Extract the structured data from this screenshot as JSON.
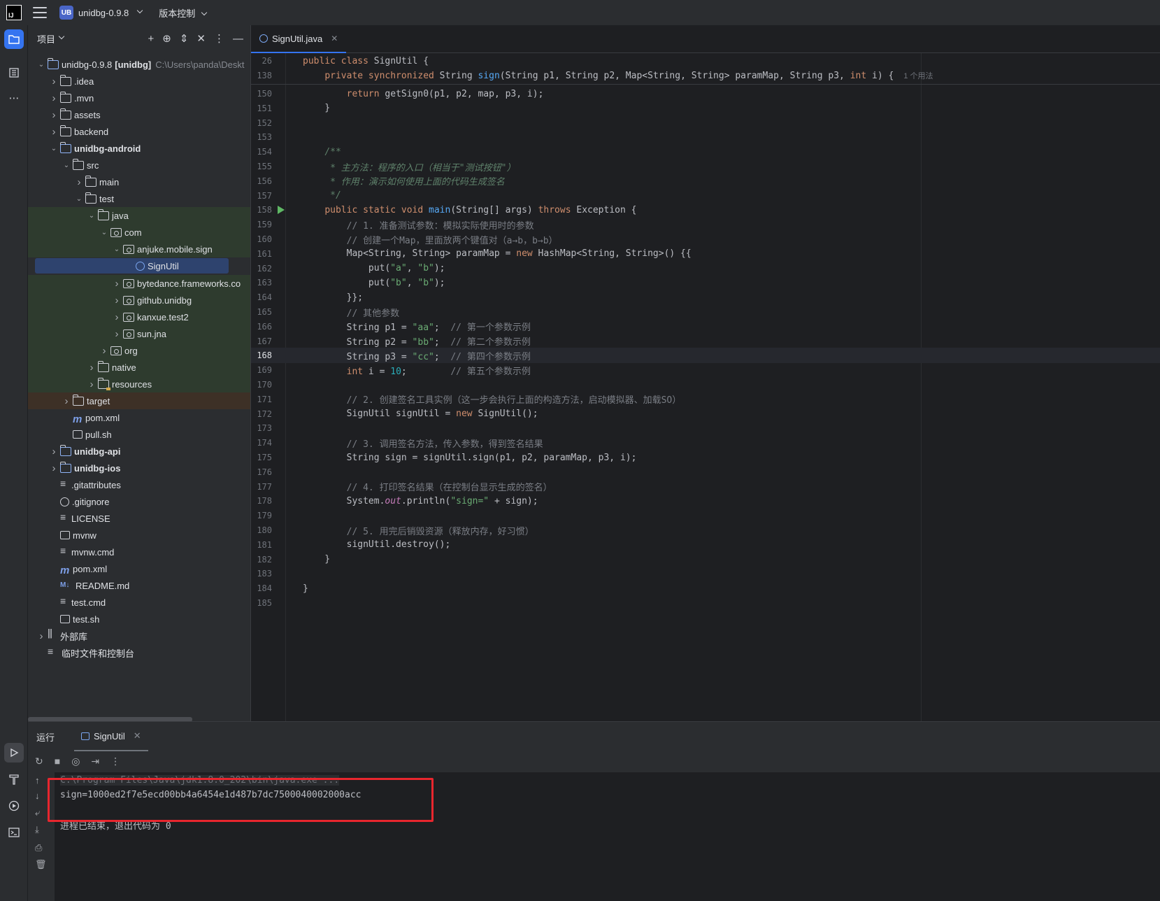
{
  "titlebar": {
    "logo_text": "IJ",
    "project_badge": "UB",
    "project_name": "unidbg-0.9.8",
    "vcs_label": "版本控制"
  },
  "project_panel": {
    "title": "项目",
    "tree": [
      {
        "label": "unidbg-0.9.8",
        "bold_suffix": "[unidbg]",
        "extra": "C:\\Users\\panda\\Deskt",
        "depth": 0,
        "arrow": "open",
        "icon": "module-folder-icon"
      },
      {
        "label": ".idea",
        "depth": 1,
        "arrow": "closed",
        "icon": "folder-icon"
      },
      {
        "label": ".mvn",
        "depth": 1,
        "arrow": "closed",
        "icon": "folder-icon"
      },
      {
        "label": "assets",
        "depth": 1,
        "arrow": "closed",
        "icon": "folder-icon"
      },
      {
        "label": "backend",
        "depth": 1,
        "arrow": "closed",
        "icon": "folder-icon"
      },
      {
        "label": "unidbg-android",
        "depth": 1,
        "arrow": "open",
        "icon": "module-folder-icon",
        "bold": true
      },
      {
        "label": "src",
        "depth": 2,
        "arrow": "open",
        "icon": "folder-icon"
      },
      {
        "label": "main",
        "depth": 3,
        "arrow": "closed",
        "icon": "folder-icon"
      },
      {
        "label": "test",
        "depth": 3,
        "arrow": "open",
        "icon": "folder-icon"
      },
      {
        "label": "java",
        "depth": 4,
        "arrow": "open",
        "icon": "folder-icon",
        "bg": "green"
      },
      {
        "label": "com",
        "depth": 5,
        "arrow": "open",
        "icon": "package-icon",
        "bg": "green"
      },
      {
        "label": "anjuke.mobile.sign",
        "depth": 6,
        "arrow": "open",
        "icon": "package-icon",
        "bg": "green"
      },
      {
        "label": "SignUtil",
        "depth": 7,
        "arrow": "none",
        "icon": "java-class-icon",
        "bg": "selected"
      },
      {
        "label": "bytedance.frameworks.co",
        "depth": 6,
        "arrow": "closed",
        "icon": "package-icon",
        "bg": "green"
      },
      {
        "label": "github.unidbg",
        "depth": 6,
        "arrow": "closed",
        "icon": "package-icon",
        "bg": "green"
      },
      {
        "label": "kanxue.test2",
        "depth": 6,
        "arrow": "closed",
        "icon": "package-icon",
        "bg": "green"
      },
      {
        "label": "sun.jna",
        "depth": 6,
        "arrow": "closed",
        "icon": "package-icon",
        "bg": "green"
      },
      {
        "label": "org",
        "depth": 5,
        "arrow": "closed",
        "icon": "package-icon",
        "bg": "green"
      },
      {
        "label": "native",
        "depth": 4,
        "arrow": "closed",
        "icon": "folder-icon",
        "bg": "green"
      },
      {
        "label": "resources",
        "depth": 4,
        "arrow": "closed",
        "icon": "resources-folder-icon",
        "bg": "green"
      },
      {
        "label": "target",
        "depth": 2,
        "arrow": "closed",
        "icon": "folder-icon",
        "bg": "brown"
      },
      {
        "label": "pom.xml",
        "depth": 2,
        "arrow": "none",
        "icon": "maven-icon"
      },
      {
        "label": "pull.sh",
        "depth": 2,
        "arrow": "none",
        "icon": "terminal-file-icon"
      },
      {
        "label": "unidbg-api",
        "depth": 1,
        "arrow": "closed",
        "icon": "module-folder-icon",
        "bold": true
      },
      {
        "label": "unidbg-ios",
        "depth": 1,
        "arrow": "closed",
        "icon": "module-folder-icon",
        "bold": true
      },
      {
        "label": ".gitattributes",
        "depth": 1,
        "arrow": "none",
        "icon": "text-file-icon"
      },
      {
        "label": ".gitignore",
        "depth": 1,
        "arrow": "none",
        "icon": "ignore-file-icon"
      },
      {
        "label": "LICENSE",
        "depth": 1,
        "arrow": "none",
        "icon": "text-file-icon"
      },
      {
        "label": "mvnw",
        "depth": 1,
        "arrow": "none",
        "icon": "terminal-file-icon"
      },
      {
        "label": "mvnw.cmd",
        "depth": 1,
        "arrow": "none",
        "icon": "text-file-icon"
      },
      {
        "label": "pom.xml",
        "depth": 1,
        "arrow": "none",
        "icon": "maven-icon"
      },
      {
        "label": "README.md",
        "depth": 1,
        "arrow": "none",
        "icon": "markdown-icon"
      },
      {
        "label": "test.cmd",
        "depth": 1,
        "arrow": "none",
        "icon": "text-file-icon"
      },
      {
        "label": "test.sh",
        "depth": 1,
        "arrow": "none",
        "icon": "terminal-file-icon"
      },
      {
        "label": "外部库",
        "depth": 0,
        "arrow": "closed",
        "icon": "library-icon"
      },
      {
        "label": "临时文件和控制台",
        "depth": 0,
        "arrow": "none",
        "icon": "scratches-icon"
      }
    ]
  },
  "editor": {
    "tab_label": "SignUtil.java",
    "usage_hint": "1 个用法",
    "lines": [
      {
        "n": "26",
        "html": "<span class=\"kw\">public class</span> SignUtil {"
      },
      {
        "n": "138",
        "html": "    <span class=\"kw\">private synchronized</span> String <span class=\"fn\">sign</span>(String p1, String p2, Map&lt;String, String&gt; paramMap, String p3, <span class=\"kw\">int</span> i) {"
      },
      {
        "n": "150",
        "html": "        <span class=\"kw\">return</span> getSign0(p1, p2, map, p3, i);"
      },
      {
        "n": "151",
        "html": "    }"
      },
      {
        "n": "152",
        "html": ""
      },
      {
        "n": "153",
        "html": ""
      },
      {
        "n": "154",
        "html": "    <span class=\"doc\">/**</span>"
      },
      {
        "n": "155",
        "html": "<span class=\"doc\">     * 主方法：程序的入口（相当于\"测试按钮\"）</span>"
      },
      {
        "n": "156",
        "html": "<span class=\"doc\">     * 作用：演示如何使用上面的代码生成签名</span>"
      },
      {
        "n": "157",
        "html": "<span class=\"doc\">     */</span>"
      },
      {
        "n": "158",
        "html": "    <span class=\"kw\">public static void</span> <span class=\"fn\">main</span>(String[] args) <span class=\"kw\">throws</span> Exception {"
      },
      {
        "n": "159",
        "html": "        <span class=\"cmt\">// 1. 准备测试参数：模拟实际使用时的参数</span>"
      },
      {
        "n": "160",
        "html": "        <span class=\"cmt\">// 创建一个Map，里面放两个键值对（a→b，b→b）</span>"
      },
      {
        "n": "161",
        "html": "        Map&lt;String, String&gt; paramMap = <span class=\"kw\">new</span> HashMap&lt;String, String&gt;() {{"
      },
      {
        "n": "162",
        "html": "            put(<span class=\"str\">\"a\"</span>, <span class=\"str\">\"b\"</span>);"
      },
      {
        "n": "163",
        "html": "            put(<span class=\"str\">\"b\"</span>, <span class=\"str\">\"b\"</span>);"
      },
      {
        "n": "164",
        "html": "        }};"
      },
      {
        "n": "165",
        "html": "        <span class=\"cmt\">// 其他参数</span>"
      },
      {
        "n": "166",
        "html": "        String p1 = <span class=\"str\">\"aa\"</span>;  <span class=\"cmt\">// 第一个参数示例</span>"
      },
      {
        "n": "167",
        "html": "        String p2 = <span class=\"str\">\"bb\"</span>;  <span class=\"cmt\">// 第二个参数示例</span>"
      },
      {
        "n": "168",
        "html": "        String p3 = <span class=\"str\">\"cc\"</span>;  <span class=\"cmt\">// 第四个参数示例</span>"
      },
      {
        "n": "169",
        "html": "        <span class=\"kw\">int</span> i = <span class=\"num\">10</span>;        <span class=\"cmt\">// 第五个参数示例</span>"
      },
      {
        "n": "170",
        "html": ""
      },
      {
        "n": "171",
        "html": "        <span class=\"cmt\">// 2. 创建签名工具实例（这一步会执行上面的构造方法，启动模拟器、加载SO）</span>"
      },
      {
        "n": "172",
        "html": "        SignUtil signUtil = <span class=\"kw\">new</span> SignUtil();"
      },
      {
        "n": "173",
        "html": ""
      },
      {
        "n": "174",
        "html": "        <span class=\"cmt\">// 3. 调用签名方法，传入参数，得到签名结果</span>"
      },
      {
        "n": "175",
        "html": "        String sign = signUtil.sign(p1, p2, paramMap, p3, i);"
      },
      {
        "n": "176",
        "html": ""
      },
      {
        "n": "177",
        "html": "        <span class=\"cmt\">// 4. 打印签名结果（在控制台显示生成的签名）</span>"
      },
      {
        "n": "178",
        "html": "        System.<span class=\"stat\">out</span>.println(<span class=\"str\">\"sign=\"</span> + sign);"
      },
      {
        "n": "179",
        "html": ""
      },
      {
        "n": "180",
        "html": "        <span class=\"cmt\">// 5. 用完后销毁资源（释放内存，好习惯）</span>"
      },
      {
        "n": "181",
        "html": "        signUtil.destroy();"
      },
      {
        "n": "182",
        "html": "    }"
      },
      {
        "n": "183",
        "html": ""
      },
      {
        "n": "184",
        "html": "}"
      },
      {
        "n": "185",
        "html": ""
      }
    ],
    "current_line": "168"
  },
  "run_panel": {
    "label": "运行",
    "tab_label": "SignUtil",
    "console": {
      "cmd_line": "C:\\Program Files\\Java\\jdk1.8.0_202\\bin\\java.exe ...",
      "output": "sign=1000ed2f7e5ecd00bb4a6454e1d487b7dc7500040002000acc",
      "exit": "进程已结束，退出代码为 0"
    }
  },
  "colors": {
    "accent": "#3574f0",
    "highlight_box": "#e8262e",
    "test_folder_bg": "#2e3b2e",
    "excluded_bg": "#3d3026"
  }
}
